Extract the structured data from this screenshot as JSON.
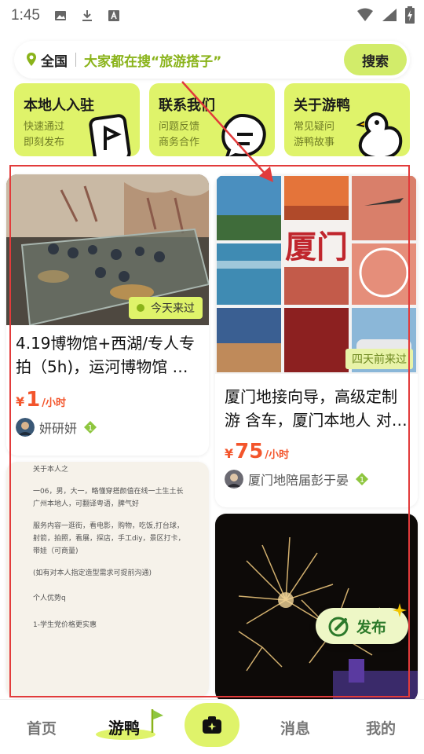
{
  "status_bar": {
    "time": "1:45"
  },
  "search": {
    "region": "全国",
    "hint": "大家都在搜“旅游搭子”",
    "button": "搜索"
  },
  "quick_cards": [
    {
      "title": "本地人入驻",
      "line1": "快速通过",
      "line2": "即刻发布"
    },
    {
      "title": "联系我们",
      "line1": "问题反馈",
      "line2": "商务合作"
    },
    {
      "title": "关于游鸭",
      "line1": "常见疑问",
      "line2": "游鸭故事"
    }
  ],
  "feed": {
    "card1": {
      "badge": "今天来过",
      "title": "4.19博物馆+西湖/专人专拍（5h)，运河博物馆 …",
      "price_currency": "¥",
      "price_value": "1",
      "price_unit": "/小时",
      "author": "妍研妍",
      "level": "1"
    },
    "card2": {
      "collage_label": "厦门",
      "badge": "四天前来过",
      "title": "厦门地接向导，高级定制游 含车，厦门本地人 对…",
      "price_currency": "¥",
      "price_value": "75",
      "price_unit": "/小时",
      "author": "厦门地陪届彭于晏",
      "level": "1"
    },
    "card3": {
      "lines": [
        "关于本人之",
        "一06，男，大一，略懂穿搭颜值在线一土生土长广州本地人，可翻译粤语，脾气好",
        "服务内容一逛街，看电影，购物，吃饭,打台球，射箭，拍照，看展，探店，手工diy，景区打卡，带娃（可商量)",
        "(如有对本人指定造型需求可提前沟通)",
        "个人优势q",
        "1-学生党价格更实惠"
      ]
    }
  },
  "fab": {
    "label": "发布"
  },
  "nav": {
    "home": "首页",
    "youya": "游鸭",
    "messages": "消息",
    "me": "我的"
  },
  "colors": {
    "accent": "#dff36a",
    "price": "#f3552c",
    "annotation": "#e23b3b"
  }
}
